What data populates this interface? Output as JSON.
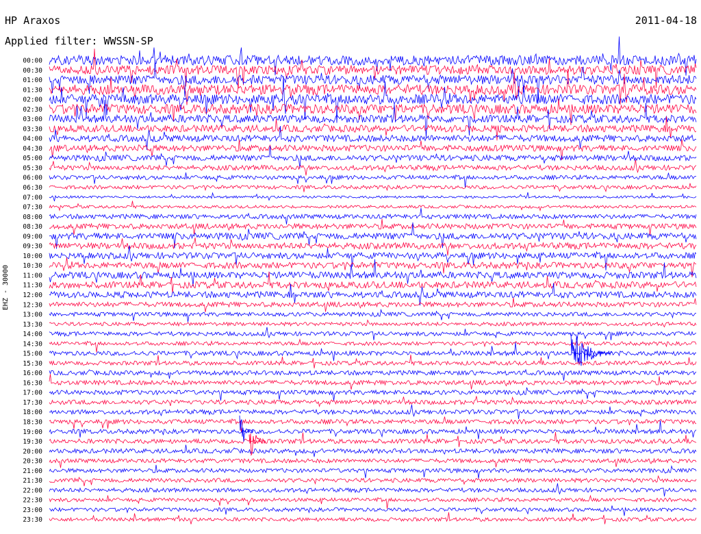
{
  "header": {
    "station": "HP Araxos",
    "date": "2011-04-18",
    "filter": "Applied filter: WWSSN-SP",
    "channel_label": "EHZ - 30000"
  },
  "chart_data": {
    "type": "line",
    "title": "HP Araxos",
    "subtitle": "Applied filter: WWSSN-SP",
    "ylabel": "EHZ - 30000",
    "xlabel": "",
    "tick_labels": [
      "00:00",
      "00:30",
      "01:00",
      "01:30",
      "02:00",
      "02:30",
      "03:00",
      "03:30",
      "04:00",
      "04:30",
      "05:00",
      "05:30",
      "06:00",
      "06:30",
      "07:00",
      "07:30",
      "08:00",
      "08:30",
      "09:00",
      "09:30",
      "10:00",
      "10:30",
      "11:00",
      "11:30",
      "12:00",
      "12:30",
      "13:00",
      "13:30",
      "14:00",
      "14:30",
      "15:00",
      "15:30",
      "16:00",
      "16:30",
      "17:00",
      "17:30",
      "18:00",
      "18:30",
      "19:00",
      "19:30",
      "20:00",
      "20:30",
      "21:00",
      "21:30",
      "22:00",
      "22:30",
      "23:00",
      "23:30"
    ],
    "series_colors": [
      "#0000ff",
      "#ff0040"
    ],
    "amplitude_level": [
      0.95,
      0.85,
      0.9,
      0.95,
      0.95,
      0.9,
      0.7,
      0.6,
      0.55,
      0.5,
      0.45,
      0.35,
      0.25,
      0.2,
      0.05,
      0.1,
      0.3,
      0.4,
      0.55,
      0.5,
      0.5,
      0.5,
      0.55,
      0.55,
      0.5,
      0.35,
      0.25,
      0.2,
      0.25,
      0.2,
      0.3,
      0.25,
      0.3,
      0.3,
      0.3,
      0.3,
      0.3,
      0.3,
      0.3,
      0.3,
      0.3,
      0.25,
      0.25,
      0.25,
      0.25,
      0.2,
      0.2,
      0.2
    ],
    "grid": false,
    "legend": "none"
  }
}
